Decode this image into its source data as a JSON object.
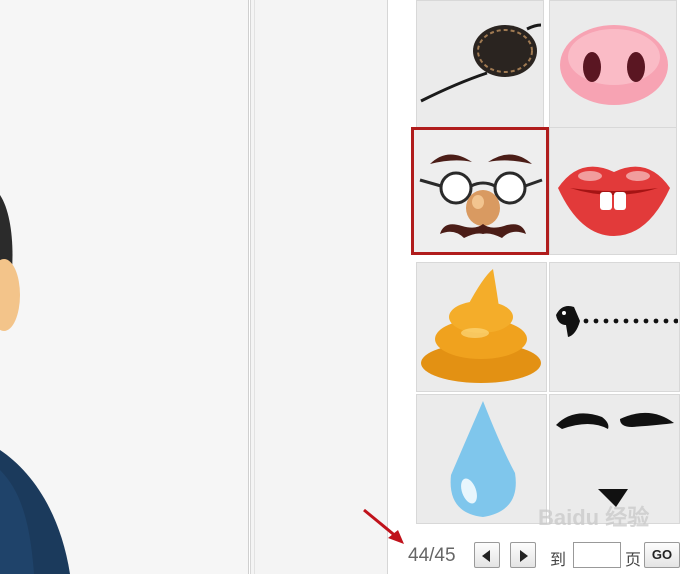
{
  "pagination": {
    "page_count": "44/45",
    "to_label": "到",
    "page_input_value": "",
    "page_label": "页",
    "go_label": "GO"
  },
  "stickers": [
    {
      "icon": "eye-patch-icon",
      "selected": false
    },
    {
      "icon": "pig-nose-icon",
      "selected": false
    },
    {
      "icon": "groucho-glasses-icon",
      "selected": true
    },
    {
      "icon": "red-lips-teeth-icon",
      "selected": false
    },
    {
      "icon": "poop-icon",
      "selected": false
    },
    {
      "icon": "bird-dotted-line-icon",
      "selected": false
    },
    {
      "icon": "water-drop-icon",
      "selected": false
    },
    {
      "icon": "mustache-goatee-icon",
      "selected": false
    }
  ],
  "watermark": "Baidu 经验",
  "colors": {
    "selection_border": "#b01c1c",
    "arrow": "#c0121b",
    "avatar_shirt": "#1b3a5c"
  }
}
